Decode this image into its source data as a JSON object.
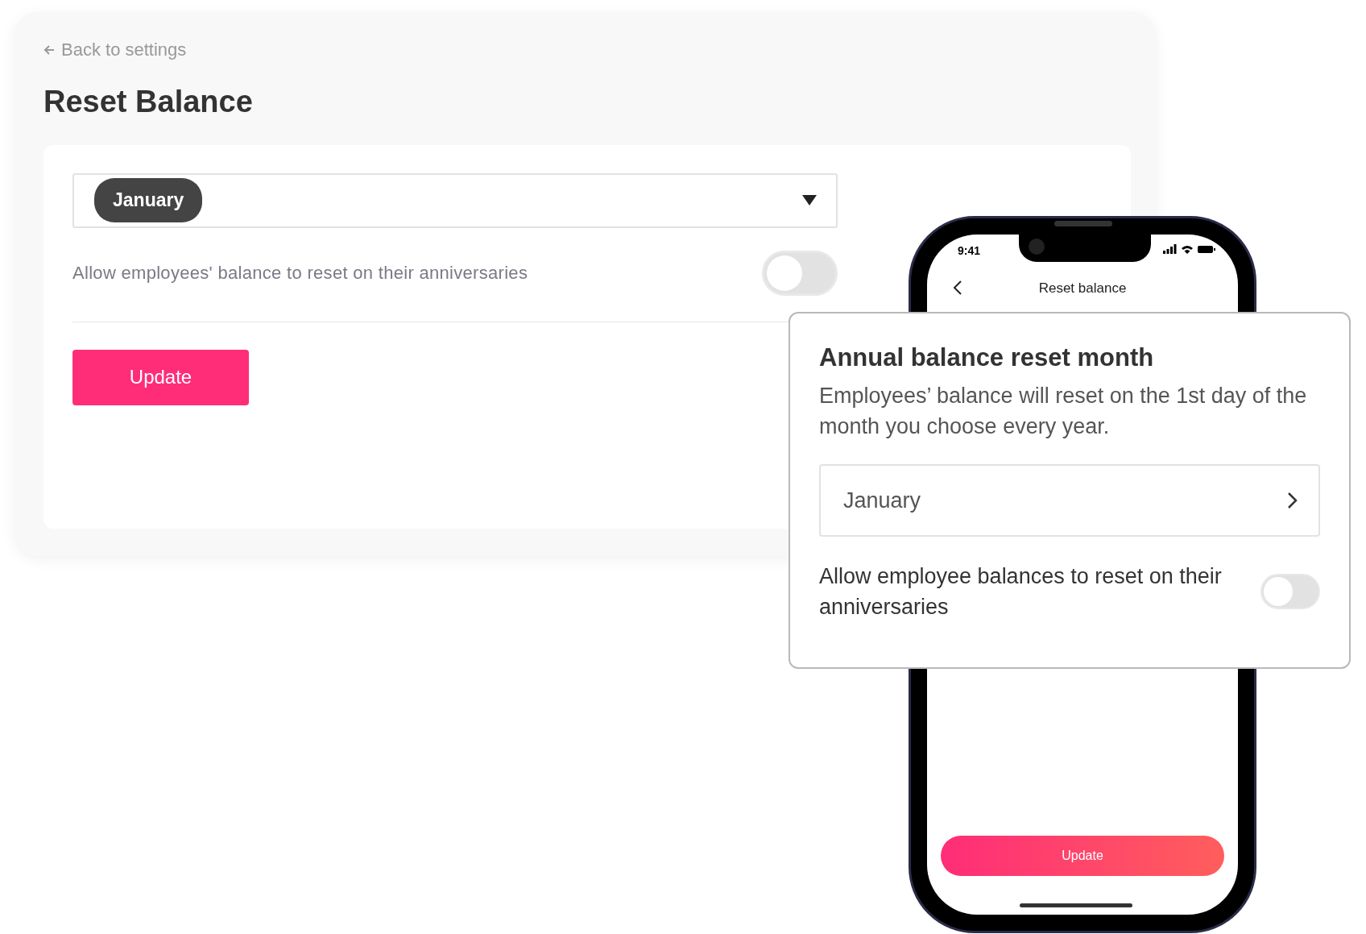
{
  "back_link": {
    "label": "Back to settings"
  },
  "title": "Reset Balance",
  "desktop_form": {
    "month_select": {
      "value": "January"
    },
    "anniversary_toggle": {
      "label": "Allow employees' balance to reset on their anniversaries",
      "on": false
    },
    "update_button": "Update"
  },
  "phone": {
    "status_bar": {
      "time": "9:41"
    },
    "nav_title": "Reset balance",
    "update_button": "Update"
  },
  "popup": {
    "title": "Annual balance reset month",
    "description": "Employees’ balance will reset on the 1st day of the month you choose every year.",
    "month_field": {
      "value": "January"
    },
    "anniversary_toggle": {
      "label": "Allow employee balances to reset on their anniversaries",
      "on": false
    }
  }
}
